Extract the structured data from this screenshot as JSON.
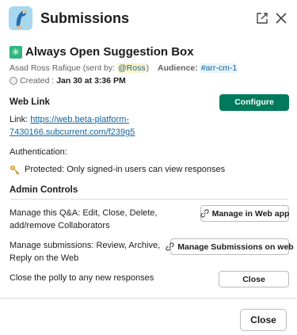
{
  "header": {
    "title": "Submissions",
    "app_icon": "bird-icon",
    "external_icon": "open-external-icon",
    "close_icon": "close-icon"
  },
  "box": {
    "emoji": "✳",
    "title": "Always Open Suggestion Box",
    "author": "Asad Ross Rafique (sent by: ",
    "sent_by": "@Ross",
    "author_suffix": ")",
    "audience_label": "Audience:",
    "audience": "#arr-cm-1",
    "created_label": "Created :",
    "created_at": "Jan 30 at 3:36 PM"
  },
  "web_link": {
    "label": "Web Link",
    "configure_label": "Configure",
    "link_prefix": "Link: ",
    "url": "https://web.beta-platform-7430166.subcurrent.com/f239g5"
  },
  "auth": {
    "label": "Authentication:",
    "protected_text": "Protected: Only signed-in users can view responses"
  },
  "admin": {
    "label": "Admin Controls",
    "manage_qa_text": "Manage this Q&A: Edit, Close, Delete, add/remove Collaborators",
    "manage_web_app_label": "Manage in Web app",
    "manage_submissions_text": "Manage submissions: Review, Archive, Reply on the Web",
    "manage_submissions_label": "Manage Submissions on web",
    "close_poll_text": "Close the polly to any new responses",
    "close_poll_label": "Close"
  },
  "footer": {
    "close_label": "Close"
  },
  "colors": {
    "primary": "#007a5a",
    "link": "#1264a3",
    "mention_bg": "#fdf4c5",
    "channel_bg": "#e8f5fa"
  }
}
